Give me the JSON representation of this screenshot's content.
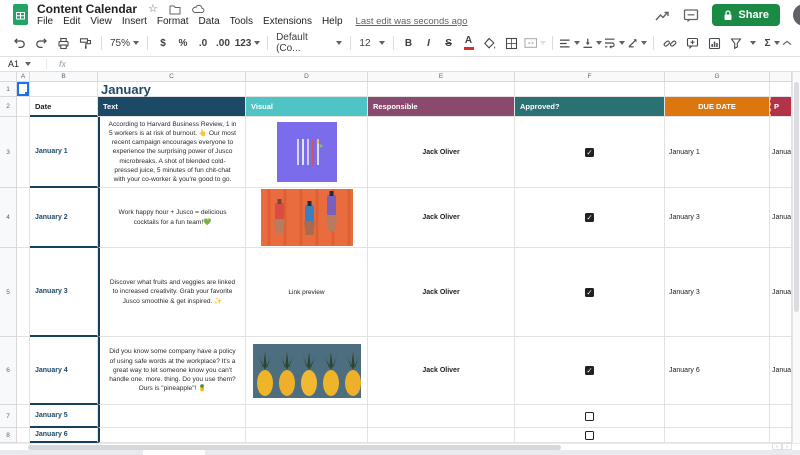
{
  "titlebar": {
    "doc_title": "Content Calendar",
    "last_edit": "Last edit was seconds ago",
    "share_label": "Share"
  },
  "menubar": {
    "items": [
      "File",
      "Edit",
      "View",
      "Insert",
      "Format",
      "Data",
      "Tools",
      "Extensions",
      "Help"
    ]
  },
  "toolbar": {
    "zoom": "75%",
    "currency": "$",
    "percent": "%",
    "decimal_decrease": ".0",
    "decimal_increase": ".00",
    "more_formats": "123",
    "font": "Default (Co...",
    "font_size": "12",
    "bold": "B",
    "italic": "I",
    "strikethrough": "S",
    "text_color": "A",
    "functions": "Σ"
  },
  "formula_bar": {
    "name_box": "A1",
    "fx_label": "fx"
  },
  "grid": {
    "col_letters": [
      "A",
      "B",
      "C",
      "D",
      "E",
      "F",
      "G"
    ],
    "row_numbers": [
      "1",
      "2",
      "3",
      "4",
      "5",
      "6",
      "7",
      "8"
    ]
  },
  "sheet": {
    "title": "January",
    "headers": {
      "date": "Date",
      "text": "Text",
      "visual": "Visual",
      "responsible": "Responsible",
      "approved": "Approved?",
      "due_date": "DUE DATE",
      "publish_clipped": "P"
    },
    "rows": [
      {
        "date": "January 1",
        "text": "According to Harvard Business Review, 1 in 5 workers is at risk of burnout. 👆 Our most recent campaign encourages everyone to experience the surprising power of Jusco microbreaks. A shot of blended cold-pressed juice, 5 minutes of fun chit-chat with your co-worker & you're good to go.",
        "visual": "pens-on-purple-image",
        "responsible": "Jack Oliver",
        "approved": true,
        "due": "January 1",
        "publish": "Janua"
      },
      {
        "date": "January 2",
        "text": "Work happy hour + Jusco = delicious cocktails for a fun team!💚",
        "visual": "cocktail-bottles-on-orange-image",
        "responsible": "Jack Oliver",
        "approved": true,
        "due": "January 3",
        "publish": "Janua"
      },
      {
        "date": "January 3",
        "text": "Discover what fruits and veggies are linked to increased creativity. Grab your favorite Jusco smoothie & get inspired. ✨",
        "visual_label": "Link preview",
        "responsible": "Jack Oliver",
        "approved": true,
        "due": "January 3",
        "publish": "Janua"
      },
      {
        "date": "January 4",
        "text": "Did you know some company have a policy of using safe words at the workplace? It's a great way to let someone know you can't handle one. more. thing. Do you use them? Ours is \"pineapple\"! 🍍",
        "visual": "pineapples-on-blue-image",
        "responsible": "Jack Oliver",
        "approved": true,
        "due": "January 6",
        "publish": "Janua"
      },
      {
        "date": "January 5",
        "approved": false
      },
      {
        "date": "January 6",
        "approved": false
      }
    ],
    "colors": {
      "header_text_bg": "#1c4966",
      "header_visual_bg": "#4fc4c5",
      "header_responsible_bg": "#8a4a6e",
      "header_approved_bg": "#2a7174",
      "header_due_bg": "#dc760f",
      "header_publish_bg": "#b23349",
      "date_text": "#1c4966",
      "selection_blue": "#1a73e8",
      "share_green": "#1b8a44",
      "logo_green": "#21a464"
    }
  },
  "icons": {
    "star": "☆",
    "functions": "Σ",
    "collapse_toolbar": "⌃",
    "scroll_left": "‹",
    "scroll_right": "›"
  }
}
